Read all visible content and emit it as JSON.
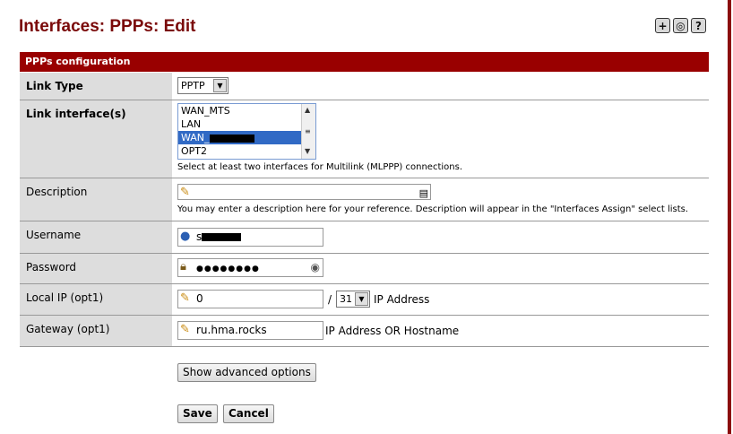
{
  "page": {
    "title": "Interfaces: PPPs: Edit"
  },
  "top_icons": [
    "add-icon",
    "settings-icon",
    "help-icon"
  ],
  "section": {
    "title": "PPPs configuration"
  },
  "link_type": {
    "label": "Link Type",
    "value": "PPTP"
  },
  "link_interfaces": {
    "label": "Link interface(s)",
    "options": [
      "WAN_MTS",
      "LAN",
      "WAN_",
      "OPT2"
    ],
    "selected": "WAN_",
    "help": "Select at least two interfaces for Multilink (MLPPP) connections."
  },
  "description": {
    "label": "Description",
    "value": "",
    "help": "You may enter a description here for your reference. Description will appear in the \"Interfaces Assign\" select lists."
  },
  "username": {
    "label": "Username",
    "value": "s"
  },
  "password": {
    "label": "Password",
    "value": "●●●●●●●●"
  },
  "local_ip": {
    "label": "Local IP (opt1)",
    "value": "0",
    "separator": "/",
    "mask": "31",
    "suffix": "IP Address"
  },
  "gateway": {
    "label": "Gateway (opt1)",
    "value": "ru.hma.rocks",
    "suffix": "IP Address OR Hostname"
  },
  "buttons": {
    "advanced": "Show advanced options",
    "save": "Save",
    "cancel": "Cancel"
  },
  "colors": {
    "header_bg": "#990000",
    "title": "#7a0a0a",
    "selected": "#316ac5"
  }
}
